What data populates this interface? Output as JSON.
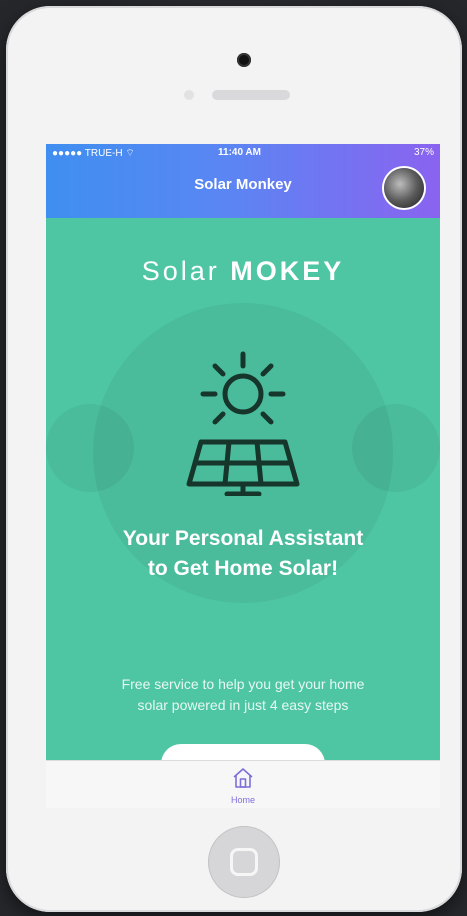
{
  "status_bar": {
    "carrier": "●●●●● TRUE-H ⌔",
    "time": "11:40 AM",
    "battery": "37%"
  },
  "nav": {
    "title": "Solar Monkey"
  },
  "hero": {
    "title_light": "Solar",
    "title_bold": "MOKEY",
    "tagline_line1": "Your Personal Assistant",
    "tagline_line2": "to Get Home Solar!",
    "description_line1": "Free service to help you get your home",
    "description_line2": "solar powered in just 4 easy steps"
  },
  "tabbar": {
    "home_label": "Home"
  },
  "colors": {
    "nav_gradient_start": "#3f8ff0",
    "nav_gradient_end": "#8a63f0",
    "content_bg": "#4ec6a4",
    "icon_stroke": "#16362c",
    "tab_active": "#7d6fd8"
  },
  "icons": {
    "sun": "sun-icon",
    "panel": "solar-panel-icon",
    "home": "home-icon"
  }
}
